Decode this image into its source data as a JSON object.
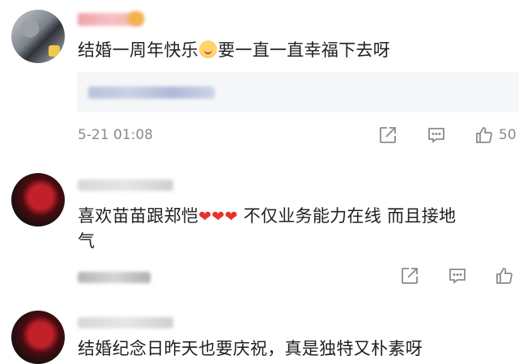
{
  "comments": [
    {
      "text_before": "结婚一周年快乐",
      "emoji": "grinning-face-emoji",
      "text_after": "要一直一直幸福下去呀",
      "timestamp": "5-21 01:08",
      "like_count": "50"
    },
    {
      "text_line1_before": "喜欢苗苗跟郑恺",
      "hearts": "❤❤❤",
      "text_line1_after": " 不仅业务能力在线 而且接地",
      "text_line2": "气"
    },
    {
      "text": "结婚纪念日昨天也要庆祝，真是独特又朴素呀"
    }
  ],
  "icons": {
    "share": "share-icon",
    "comment": "comment-icon",
    "like": "thumbs-up-icon"
  },
  "colors": {
    "icon_gray": "#8a8a8a",
    "heart_red": "#e8302c",
    "quote_bg": "#f5f6f8"
  }
}
